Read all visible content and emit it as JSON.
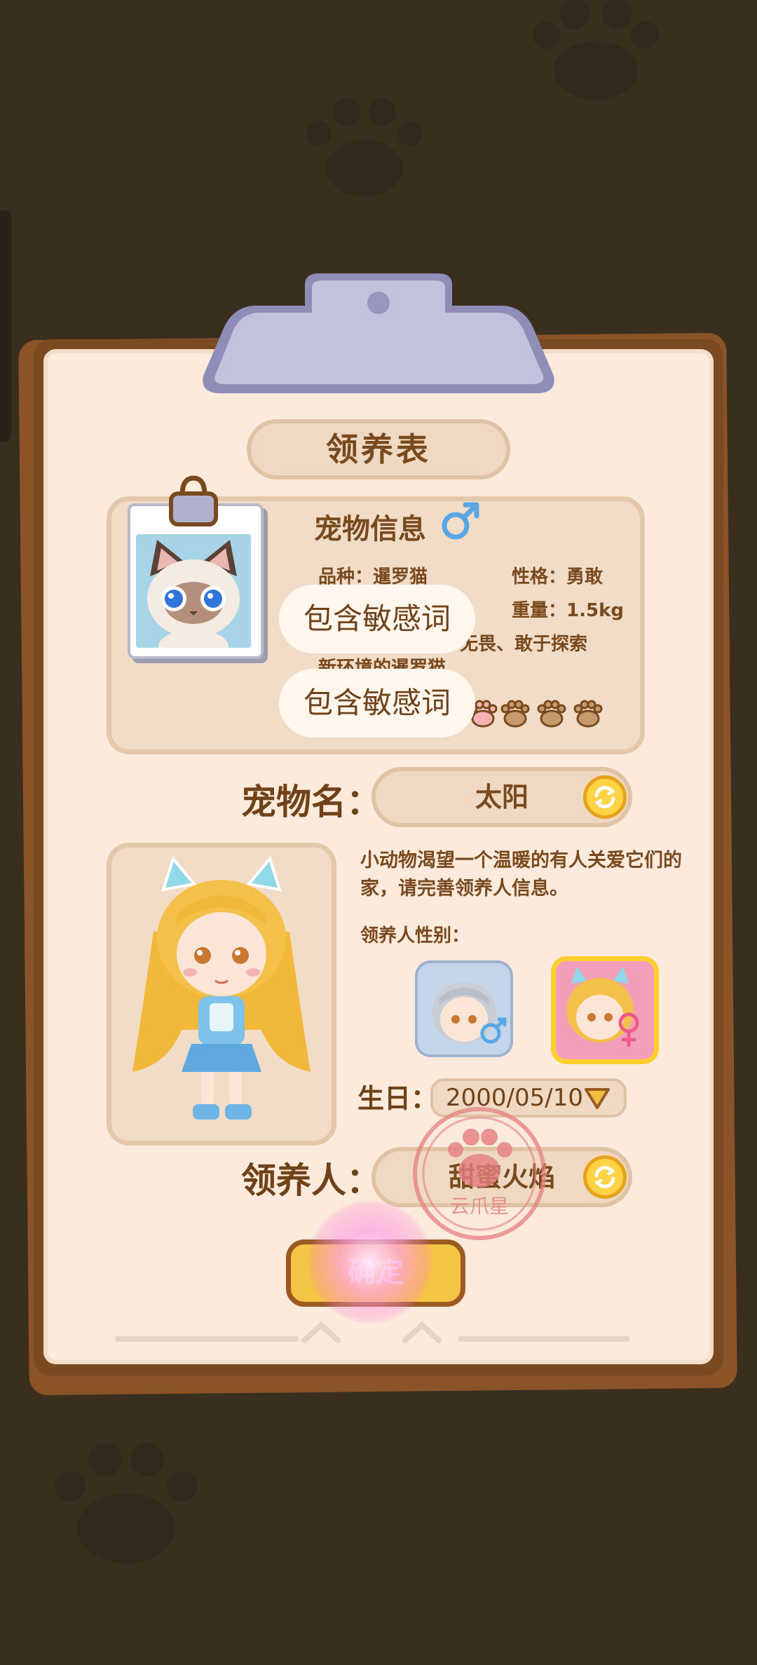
{
  "form": {
    "title": "领养表"
  },
  "pet_info": {
    "heading": "宠物信息",
    "gender_icon": "male-symbol-icon",
    "breed_label": "品种：",
    "breed_value": "暹罗猫",
    "personality_label": "性格：",
    "personality_value": "勇敢",
    "weight_label": "重量：",
    "weight_value": "1.5kg",
    "description_fragment_1": "无畏、敢于探索",
    "description_fragment_2": "新环境的暹罗猫",
    "paw_rating_icons": 4
  },
  "censor": {
    "text_1": "包含敏感词",
    "text_2": "包含敏感词"
  },
  "pet_name": {
    "label": "宠物名：",
    "value": "太阳",
    "refresh_icon": "refresh-icon"
  },
  "adopter": {
    "intro": "小动物渴望一个温暖的有人关爱它们的家，请完善领养人信息。",
    "gender_label": "领养人性别：",
    "gender_options": [
      "male",
      "female"
    ],
    "selected_gender": "female",
    "birthday_label": "生日：",
    "birthday_value": "2000/05/10",
    "name_label": "领养人：",
    "name_value": "甜蜜火焰",
    "refresh_icon": "refresh-icon"
  },
  "stamp": {
    "text": "云爪星",
    "icon": "paw-stamp-icon"
  },
  "confirm": {
    "label": "确定"
  },
  "colors": {
    "background": "#3a2f1f",
    "paper": "#fcebdc",
    "text_brown": "#7a4a1f",
    "button_yellow": "#f4c545",
    "male_blue": "#5aa7e6",
    "female_pink": "#ef5a8c"
  }
}
